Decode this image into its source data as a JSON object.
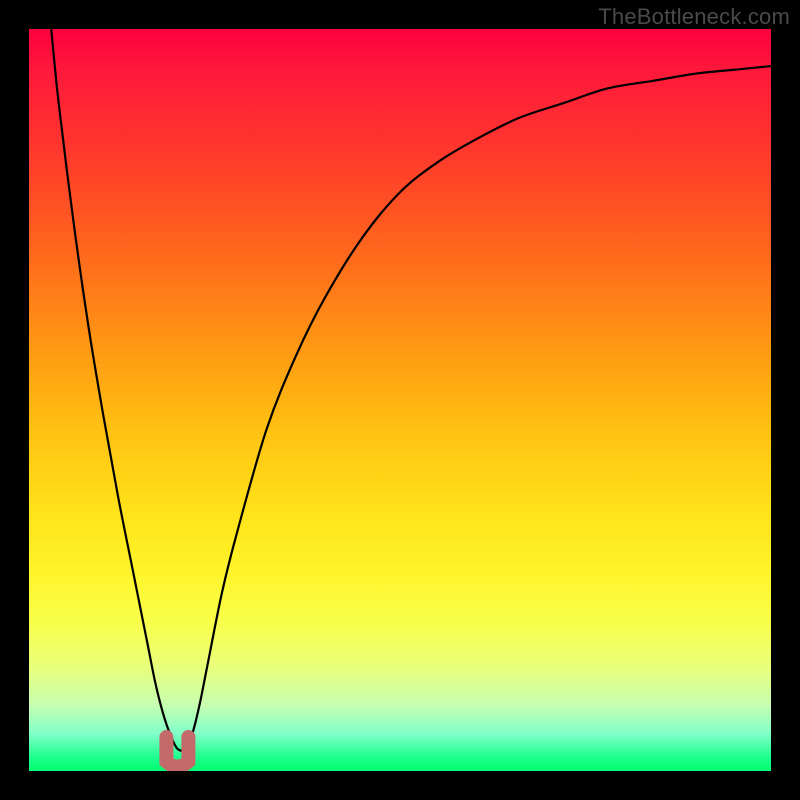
{
  "watermark": "TheBottleneck.com",
  "chart_data": {
    "type": "line",
    "title": "",
    "xlabel": "",
    "ylabel": "",
    "xlim": [
      0,
      100
    ],
    "ylim": [
      0,
      100
    ],
    "grid": false,
    "series": [
      {
        "name": "curve",
        "x": [
          3,
          4,
          6,
          8,
          10,
          12,
          14,
          16,
          17,
          18,
          19,
          20,
          21,
          22,
          23,
          24,
          26,
          28,
          32,
          36,
          40,
          45,
          50,
          55,
          60,
          66,
          72,
          78,
          84,
          90,
          96,
          100
        ],
        "y": [
          100,
          90,
          74,
          60,
          48,
          37,
          27,
          17,
          12,
          8,
          5,
          3,
          3,
          5,
          9,
          14,
          24,
          32,
          46,
          56,
          64,
          72,
          78,
          82,
          85,
          88,
          90,
          92,
          93,
          94,
          94.6,
          95
        ]
      }
    ],
    "marker": {
      "x": 20,
      "y_from": 1,
      "y_to": 3.5
    },
    "colors": {
      "curve": "#000000",
      "marker": "#c56a6a",
      "gradient_top": "#ff0040",
      "gradient_bottom": "#00ff70"
    }
  }
}
